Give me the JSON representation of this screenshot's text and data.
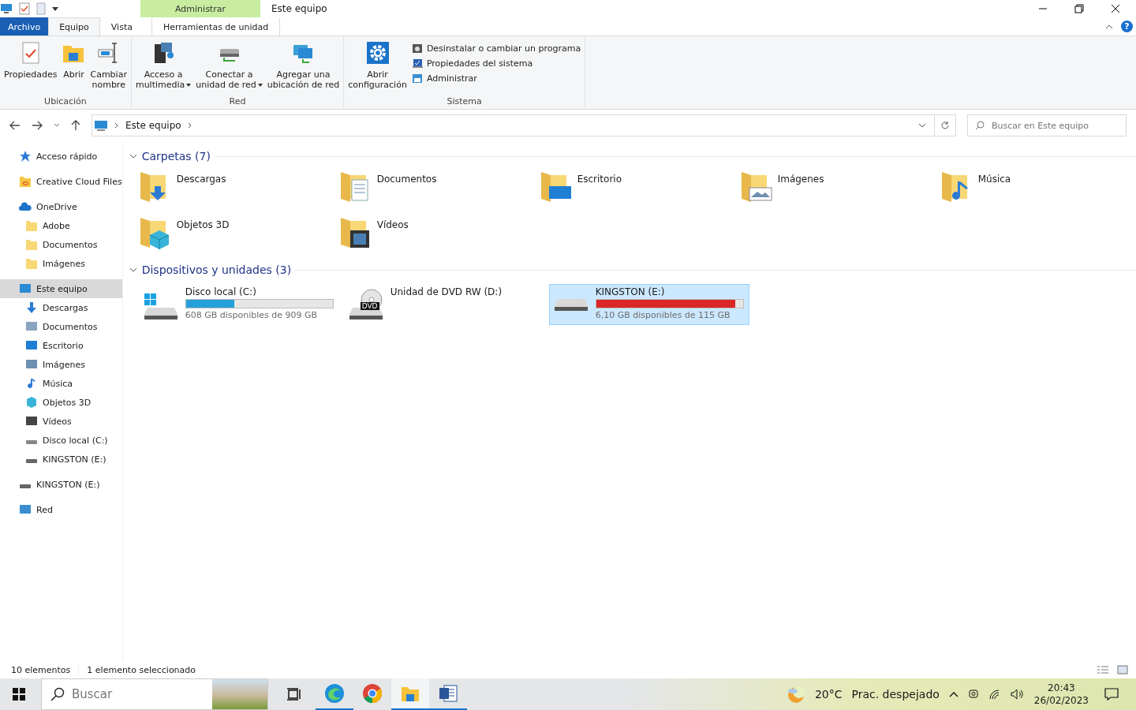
{
  "title_bar": {
    "context_tab": "Administrar",
    "title": "Este equipo",
    "help_label": "?"
  },
  "ribbon_tabs": [
    {
      "label": "Archivo",
      "kind": "file",
      "selected": false
    },
    {
      "label": "Equipo",
      "kind": "tab",
      "selected": true
    },
    {
      "label": "Vista",
      "kind": "tab",
      "selected": false
    },
    {
      "label": "Herramientas de unidad",
      "kind": "context",
      "selected": false
    }
  ],
  "ribbon_groups": [
    {
      "name": "Ubicación",
      "buttons": [
        {
          "lines": [
            "Propiedades"
          ],
          "dropdown": false
        },
        {
          "lines": [
            "Abrir"
          ],
          "dropdown": false
        },
        {
          "lines": [
            "Cambiar",
            "nombre"
          ],
          "dropdown": false
        }
      ]
    },
    {
      "name": "Red",
      "buttons": [
        {
          "lines": [
            "Acceso a",
            "multimedia"
          ],
          "dropdown": true
        },
        {
          "lines": [
            "Conectar a",
            "unidad de red"
          ],
          "dropdown": true
        },
        {
          "lines": [
            "Agregar una",
            "ubicación de red"
          ],
          "dropdown": false
        }
      ]
    },
    {
      "name": "Sistema",
      "buttons": [
        {
          "lines": [
            "Abrir",
            "configuración"
          ],
          "dropdown": false
        }
      ],
      "small_buttons": [
        {
          "label": "Desinstalar o cambiar un programa"
        },
        {
          "label": "Propiedades del sistema"
        },
        {
          "label": "Administrar"
        }
      ]
    }
  ],
  "address_bar": {
    "path": "Este equipo"
  },
  "search": {
    "placeholder": "Buscar en Este equipo"
  },
  "sidebar": {
    "items": [
      {
        "label": "Acceso rápido",
        "selected": false
      },
      {
        "label": "Creative Cloud Files",
        "selected": false
      },
      {
        "label": "OneDrive",
        "selected": false,
        "children": [
          {
            "label": "Adobe",
            "selected": false
          },
          {
            "label": "Documentos",
            "selected": false
          },
          {
            "label": "Imágenes",
            "selected": false
          }
        ]
      },
      {
        "label": "Este equipo",
        "selected": true,
        "children": [
          {
            "label": "Descargas",
            "selected": false
          },
          {
            "label": "Documentos",
            "selected": false
          },
          {
            "label": "Escritorio",
            "selected": false
          },
          {
            "label": "Imágenes",
            "selected": false
          },
          {
            "label": "Música",
            "selected": false
          },
          {
            "label": "Objetos 3D",
            "selected": false
          },
          {
            "label": "Vídeos",
            "selected": false
          },
          {
            "label": "Disco local (C:)",
            "selected": false
          },
          {
            "label": "KINGSTON (E:)",
            "selected": false
          }
        ]
      },
      {
        "label": "KINGSTON (E:)",
        "selected": false
      },
      {
        "label": "Red",
        "selected": false
      }
    ]
  },
  "folders": {
    "title": "Carpetas (7)",
    "expanded": true,
    "items": [
      {
        "name": "Descargas",
        "kind": "download"
      },
      {
        "name": "Documentos",
        "kind": "docs"
      },
      {
        "name": "Escritorio",
        "kind": "desktop"
      },
      {
        "name": "Imágenes",
        "kind": "images"
      },
      {
        "name": "Música",
        "kind": "music"
      },
      {
        "name": "Objetos 3D",
        "kind": "cube"
      },
      {
        "name": "Vídeos",
        "kind": "video"
      }
    ]
  },
  "devices": {
    "title": "Dispositivos y unidades (3)",
    "expanded": true,
    "items": [
      {
        "name": "Disco local (C:)",
        "kind": "system",
        "level": 0.33,
        "free": "608 GB disponibles de 909 GB",
        "selected": false
      },
      {
        "name": "Unidad de DVD RW (D:)",
        "kind": "dvd",
        "dvd_label": "DVD",
        "selected": false
      },
      {
        "name": "KINGSTON (E:)",
        "kind": "usb",
        "level": 0.95,
        "free": "6,10 GB disponibles de 115 GB",
        "selected": true
      }
    ]
  },
  "status_bar": {
    "count": "10 elementos",
    "selection": "1 elemento seleccionado"
  },
  "taskbar": {
    "search_placeholder": "Buscar",
    "apps": [
      {
        "kind": "edge",
        "running": true,
        "selected": false
      },
      {
        "kind": "chrome",
        "running": false,
        "selected": false
      },
      {
        "kind": "explorer",
        "running": true,
        "selected": true
      },
      {
        "kind": "word",
        "running": true,
        "selected": false
      }
    ],
    "weather": {
      "temperature": "20°C",
      "condition": "Prac. despejado"
    },
    "time": "20:43",
    "date": "26/02/2023"
  }
}
